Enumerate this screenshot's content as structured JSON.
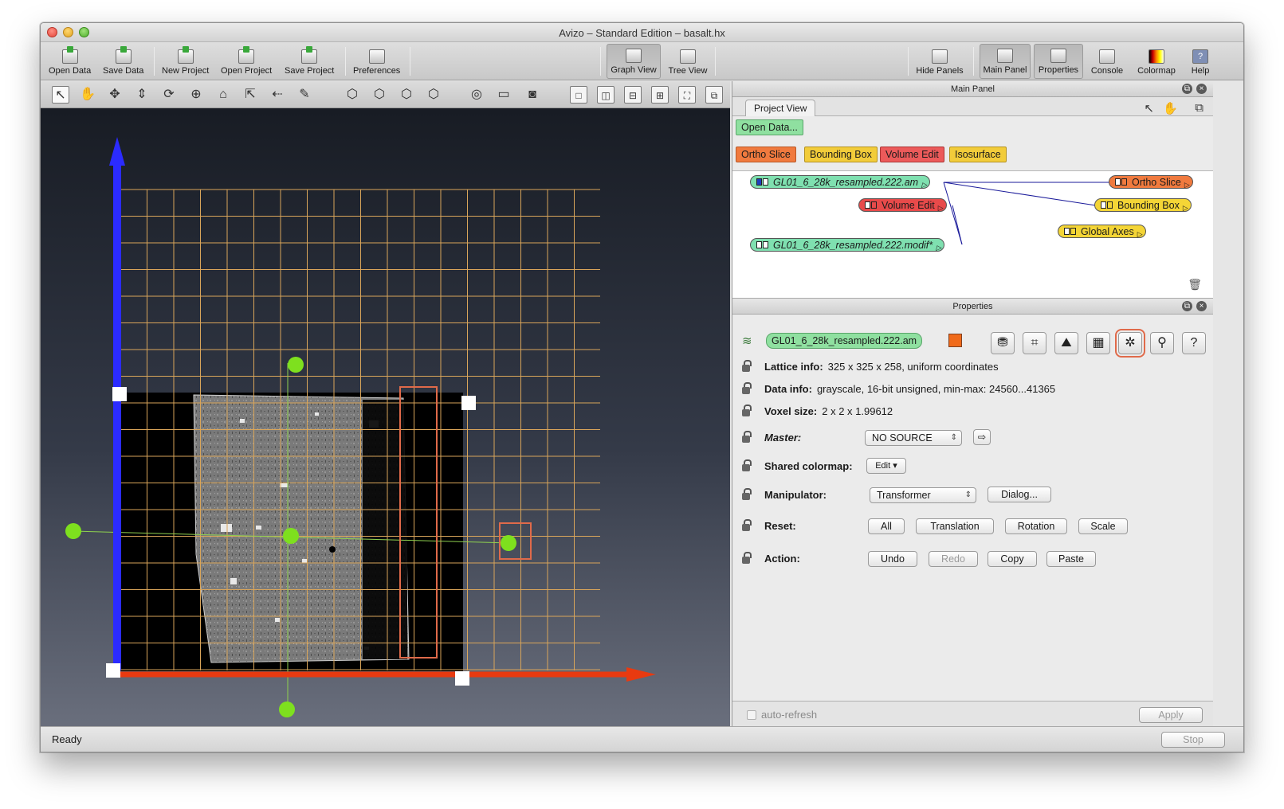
{
  "window": {
    "title": "Avizo – Standard Edition – basalt.hx"
  },
  "toolbar": {
    "open_data": "Open Data",
    "save_data": "Save Data",
    "new_project": "New Project",
    "open_project": "Open Project",
    "save_project": "Save Project",
    "preferences": "Preferences",
    "graph_view": "Graph View",
    "tree_view": "Tree View",
    "hide_panels": "Hide Panels",
    "main_panel": "Main Panel",
    "properties": "Properties",
    "console": "Console",
    "colormap": "Colormap",
    "help": "Help"
  },
  "main_panel": {
    "title": "Main Panel",
    "tab": "Project View",
    "open_data_btn": "Open Data...",
    "shortcuts": [
      "Ortho Slice",
      "Bounding Box",
      "Volume Edit",
      "Isosurface"
    ],
    "nodes": {
      "data1": "GL01_6_28k_resampled.222.am",
      "volume_edit": "Volume Edit",
      "data2": "GL01_6_28k_resampled.222.modif*",
      "ortho_slice": "Ortho Slice",
      "bounding_box": "Bounding Box",
      "global_axes": "Global Axes"
    }
  },
  "properties": {
    "title": "Properties",
    "object_name": "GL01_6_28k_resampled.222.am",
    "lattice_label": "Lattice info:",
    "lattice_value": "325 x 325 x 258, uniform coordinates",
    "data_label": "Data info:",
    "data_value": "grayscale, 16-bit unsigned, min-max: 24560...41365",
    "voxel_label": "Voxel size:",
    "voxel_value": "2 x 2 x 1.99612",
    "master_label": "Master:",
    "master_value": "NO SOURCE",
    "colormap_label": "Shared colormap:",
    "colormap_btn": "Edit",
    "manipulator_label": "Manipulator:",
    "manipulator_value": "Transformer",
    "dialog_btn": "Dialog...",
    "reset_label": "Reset:",
    "reset_buttons": [
      "All",
      "Translation",
      "Rotation",
      "Scale"
    ],
    "action_label": "Action:",
    "action_buttons": [
      "Undo",
      "Redo",
      "Copy",
      "Paste"
    ],
    "auto_refresh": "auto-refresh",
    "apply": "Apply"
  },
  "status": {
    "text": "Ready",
    "stop": "Stop"
  },
  "colors": {
    "axis_y": "#2b2bff",
    "axis_x": "#e83a10",
    "grid": "#d9a55a",
    "handle": "#7ee01e",
    "highlight": "#e06a4a"
  }
}
